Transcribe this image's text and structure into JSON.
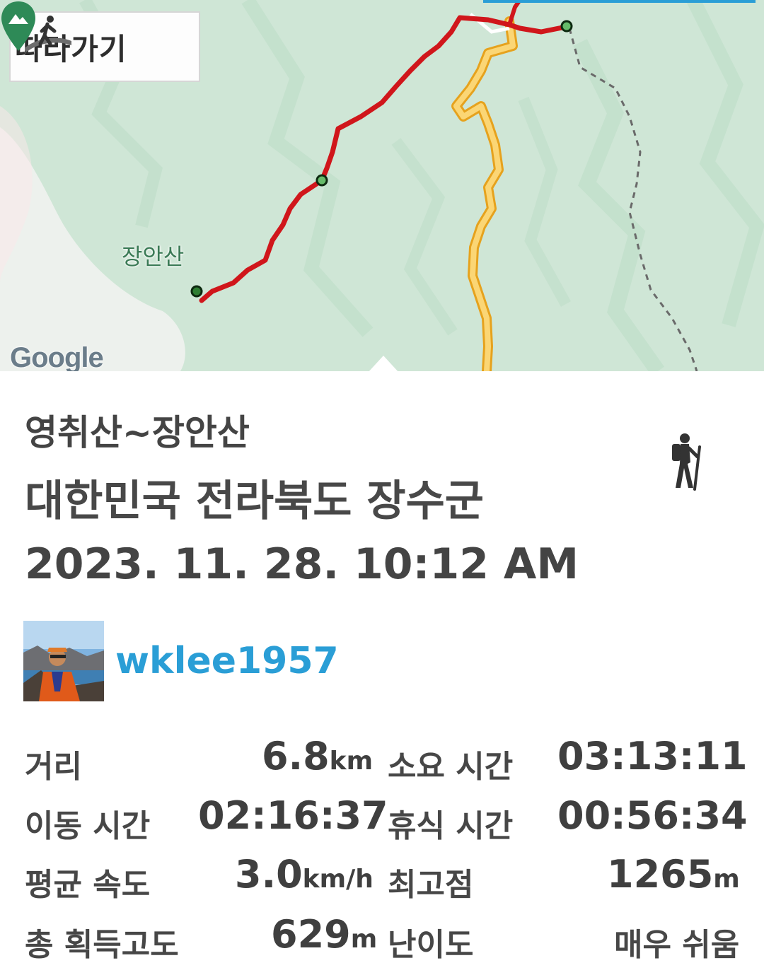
{
  "map": {
    "follow_button_label": "따라가기",
    "peak_label": "장안산",
    "attribution": "Google",
    "colors": {
      "route": "#d0161b",
      "road": "#f6c54a",
      "terrain": "#cfe6d6",
      "accent": "#2a9ed6"
    },
    "icons": [
      "walking-person-icon",
      "mountain-pin-icon",
      "waypoint-icon"
    ]
  },
  "track": {
    "title": "영취산~장안산",
    "location": "대한민국 전라북도 장수군",
    "datetime": "2023. 11. 28. 10:12 AM",
    "activity_icon": "hiker-icon",
    "user": {
      "username": "wklee1957"
    }
  },
  "stats": {
    "distance": {
      "label": "거리",
      "value": "6.8",
      "unit": "km"
    },
    "total_time": {
      "label": "소요 시간",
      "value": "03:13:11"
    },
    "moving_time": {
      "label": "이동 시간",
      "value": "02:16:37"
    },
    "rest_time": {
      "label": "휴식 시간",
      "value": "00:56:34"
    },
    "avg_speed": {
      "label": "평균 속도",
      "value": "3.0",
      "unit": "km/h"
    },
    "max_elevation": {
      "label": "최고점",
      "value": "1265",
      "unit": "m"
    },
    "elevation_gain": {
      "label": "총 획득고도",
      "value": "629",
      "unit": "m"
    },
    "difficulty": {
      "label": "난이도",
      "value": "매우 쉬움"
    }
  }
}
